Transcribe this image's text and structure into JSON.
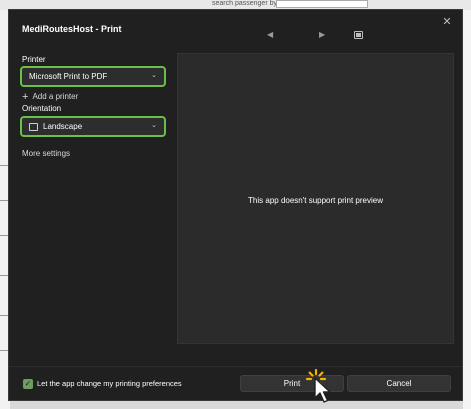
{
  "background_app": {
    "search_label": "search passenger by:"
  },
  "dialog": {
    "title": "MediRoutesHost - Print",
    "close_glyph": "✕",
    "nav": {
      "prev_glyph": "◀",
      "next_glyph": "▶",
      "fit_icon": "fit-page-icon"
    }
  },
  "printer": {
    "label": "Printer",
    "selected": "Microsoft Print to PDF",
    "add_label": "Add a printer",
    "chevron": "⌄"
  },
  "orientation": {
    "label": "Orientation",
    "selected": "Landscape",
    "chevron": "⌄",
    "icon": "landscape-page-icon"
  },
  "more_settings_label": "More settings",
  "preview": {
    "message": "This app doesn't support print preview"
  },
  "footer": {
    "checkbox_label": "Let the app change my printing preferences",
    "checkbox_checked": true,
    "print_label": "Print",
    "cancel_label": "Cancel"
  },
  "colors": {
    "accent_green": "#6abf49",
    "dialog_bg": "#202020",
    "spinner": "#f5b400"
  }
}
